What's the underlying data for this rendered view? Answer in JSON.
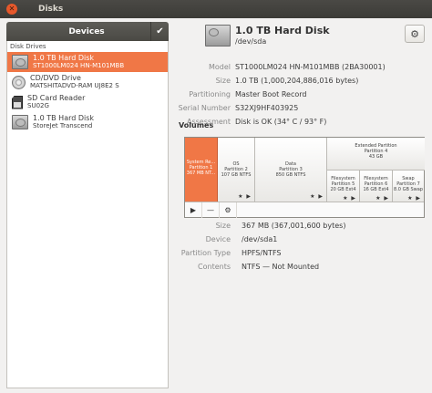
{
  "window": {
    "title": "Disks",
    "close_glyph": "✕"
  },
  "sidebar": {
    "header": "Devices",
    "check_glyph": "✔",
    "section_label": "Disk Drives",
    "devices": [
      {
        "name": "1.0 TB Hard Disk",
        "detail": "ST1000LM024 HN-M101MBB",
        "icon": "hard-disk-icon",
        "selected": true
      },
      {
        "name": "CD/DVD Drive",
        "detail": "MATSHITADVD-RAM UJ8E2 S",
        "icon": "optical-drive-icon",
        "selected": false
      },
      {
        "name": "SD Card Reader",
        "detail": "SU02G",
        "icon": "sd-card-icon",
        "selected": false
      },
      {
        "name": "1.0 TB Hard Disk",
        "detail": "StoreJet Transcend",
        "icon": "hard-disk-icon",
        "selected": false
      }
    ]
  },
  "disk": {
    "title": "1.0 TB Hard Disk",
    "path": "/dev/sda",
    "gear_glyph": "⚙",
    "properties": [
      {
        "label": "Model",
        "value": "ST1000LM024 HN-M101MBB (2BA30001)"
      },
      {
        "label": "Size",
        "value": "1.0 TB (1,000,204,886,016 bytes)"
      },
      {
        "label": "Partitioning",
        "value": "Master Boot Record"
      },
      {
        "label": "Serial Number",
        "value": "S32XJ9HF403925"
      },
      {
        "label": "Assessment",
        "value": "Disk is OK (34° C / 93° F)"
      }
    ]
  },
  "volumes": {
    "label": "Volumes",
    "partitions": [
      {
        "line1": "System Re...",
        "line2": "Partition 1",
        "line3": "367 MB NT...",
        "selected": true,
        "stars": ""
      },
      {
        "line1": "OS",
        "line2": "Partition 2",
        "line3": "107 GB NTFS",
        "selected": false,
        "stars": "★ ▶"
      },
      {
        "line1": "Data",
        "line2": "Partition 3",
        "line3": "850 GB NTFS",
        "selected": false,
        "stars": "★ ▶"
      },
      {
        "line1": "Filesystem",
        "line2": "Partition 5",
        "line3": "20 GB Ext4",
        "selected": false,
        "stars": "★ ▶"
      },
      {
        "line1": "Filesystem",
        "line2": "Partition 6",
        "line3": "16 GB Ext4",
        "selected": false,
        "stars": "★ ▶"
      },
      {
        "line1": "Swap",
        "line2": "Partition 7",
        "line3": "8.0 GB Swap",
        "selected": false,
        "stars": "★ ▶"
      }
    ],
    "extended": {
      "line1": "Extended Partition",
      "line2": "Partition 4",
      "line3": "43 GB"
    },
    "toolbar": {
      "play": "▶",
      "minus": "—",
      "settings": "⚙"
    }
  },
  "volume_details": [
    {
      "label": "Size",
      "value": "367 MB (367,001,600 bytes)"
    },
    {
      "label": "Device",
      "value": "/dev/sda1"
    },
    {
      "label": "Partition Type",
      "value": "HPFS/NTFS"
    },
    {
      "label": "Contents",
      "value": "NTFS — Not Mounted"
    }
  ]
}
